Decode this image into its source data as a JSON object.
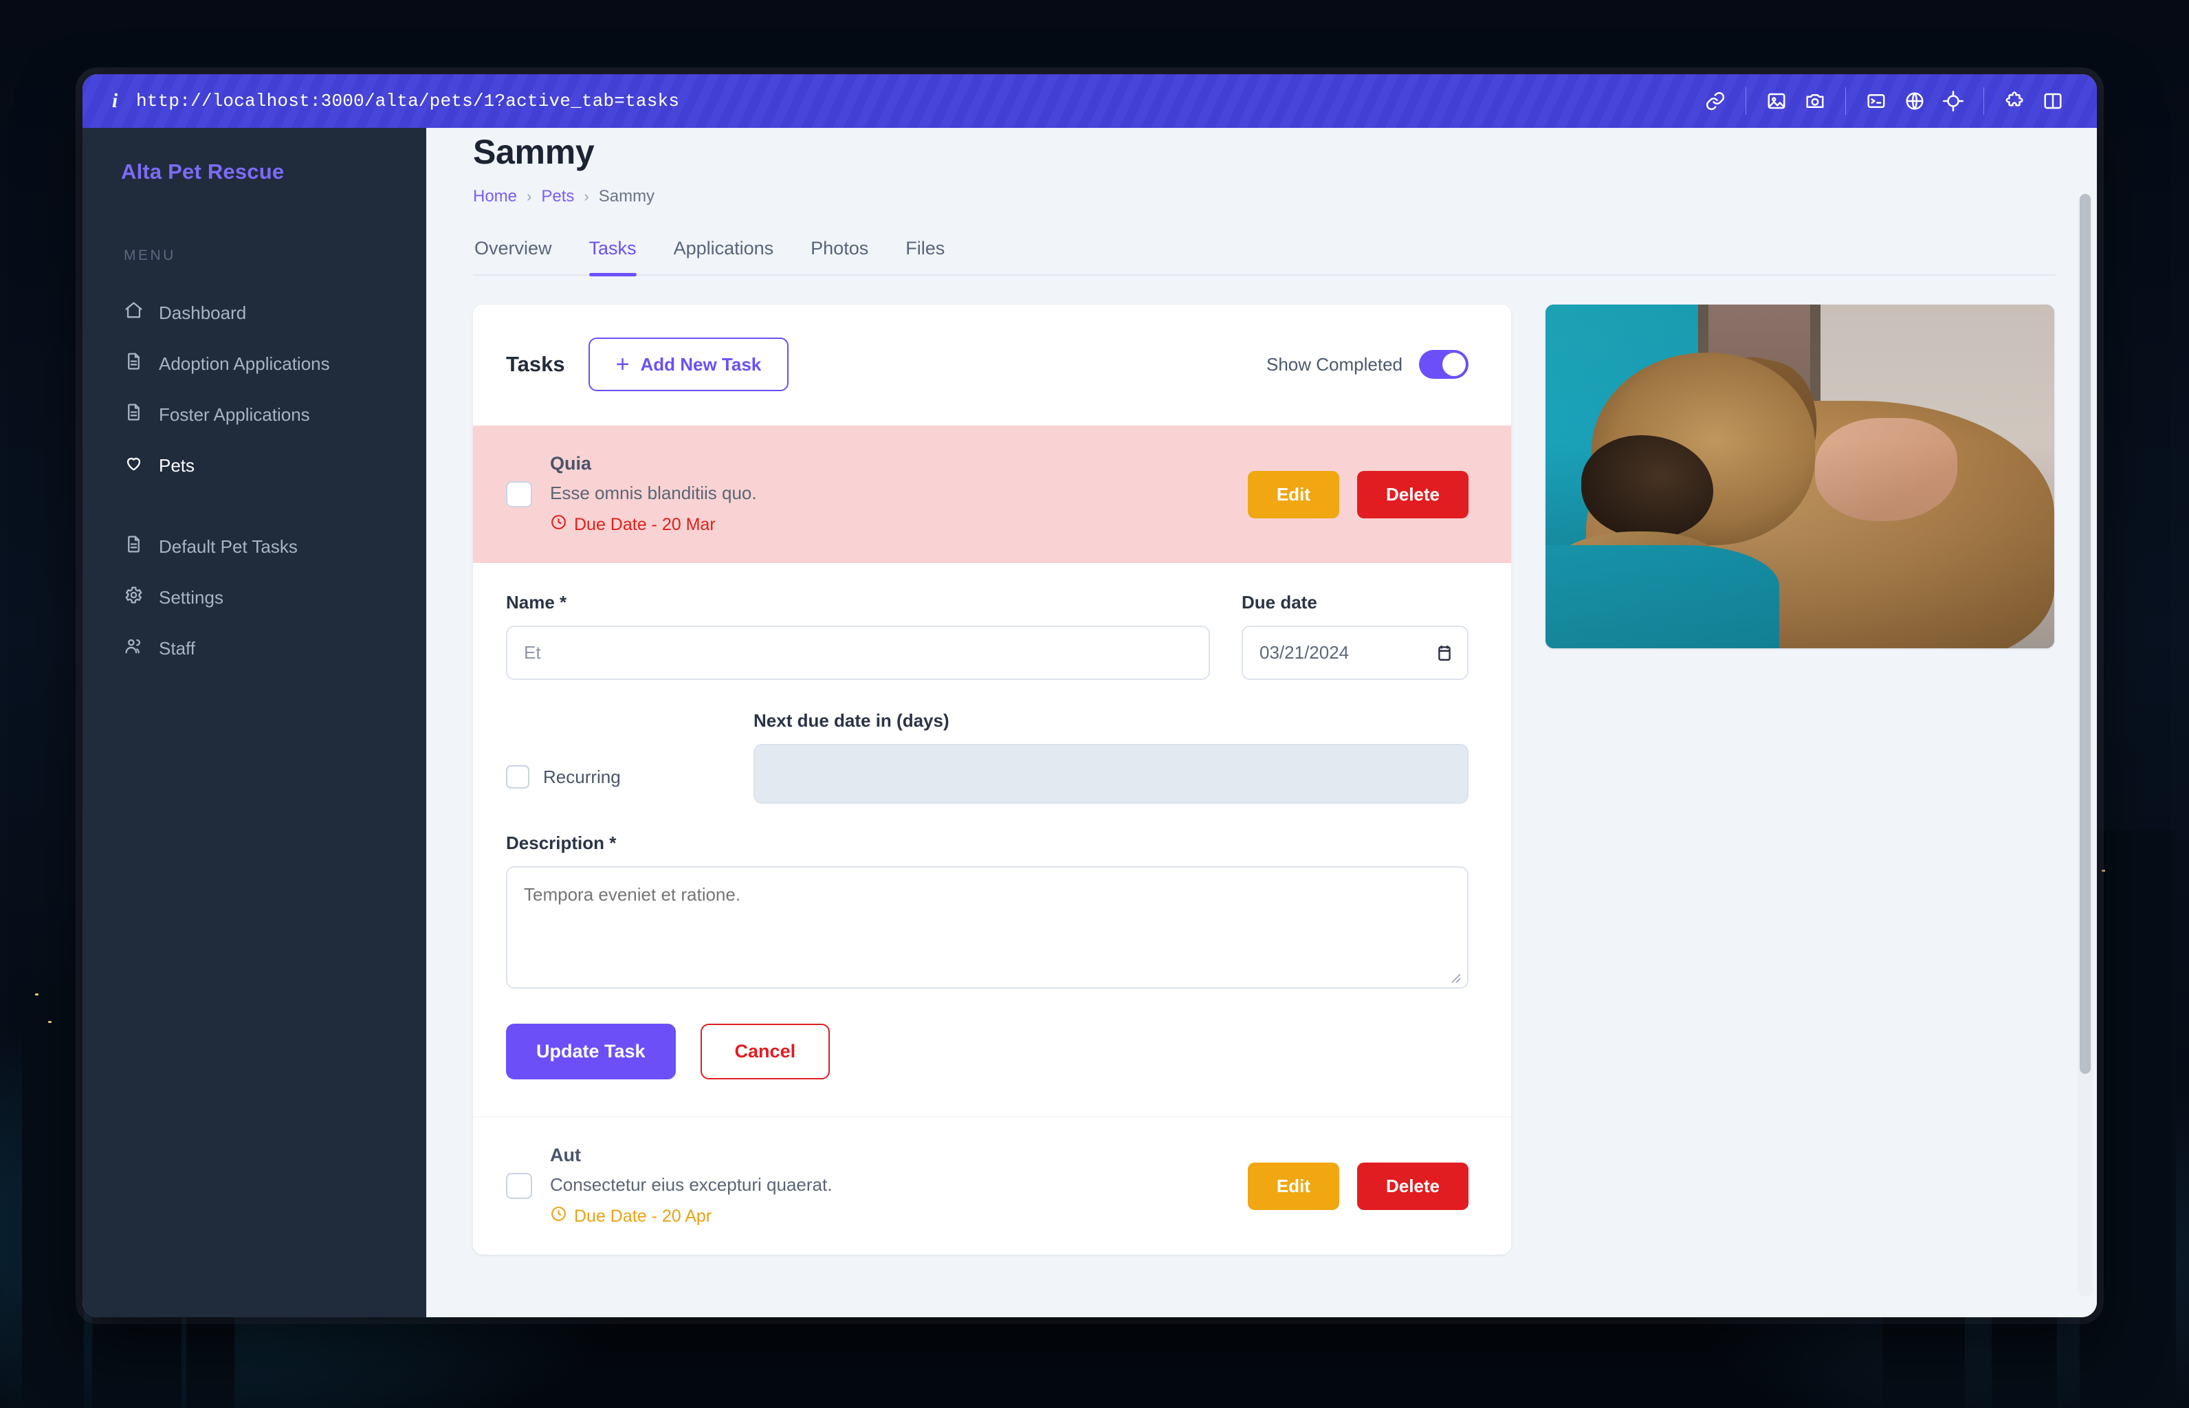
{
  "browser": {
    "info_icon": "info-icon",
    "url": "http://localhost:3000/alta/pets/1?active_tab=tasks",
    "toolbar_icons": [
      "link-icon",
      "image-icon",
      "camera-icon",
      "terminal-icon",
      "globe-icon",
      "target-icon",
      "puzzle-icon",
      "split-panel-icon"
    ]
  },
  "sidebar": {
    "brand": "Alta Pet Rescue",
    "menu_label": "MENU",
    "items": [
      {
        "label": "Dashboard",
        "icon": "home-icon",
        "active": false
      },
      {
        "label": "Adoption Applications",
        "icon": "document-icon",
        "active": false
      },
      {
        "label": "Foster Applications",
        "icon": "document-icon",
        "active": false
      },
      {
        "label": "Pets",
        "icon": "heart-icon",
        "active": true
      },
      {
        "label": "Default Pet Tasks",
        "icon": "document-icon",
        "active": false
      },
      {
        "label": "Settings",
        "icon": "gear-icon",
        "active": false
      },
      {
        "label": "Staff",
        "icon": "users-icon",
        "active": false
      }
    ]
  },
  "page": {
    "title": "Sammy",
    "breadcrumb": {
      "home": "Home",
      "pets": "Pets",
      "current": "Sammy",
      "separator": "›"
    },
    "tabs": [
      {
        "label": "Overview",
        "active": false
      },
      {
        "label": "Tasks",
        "active": true
      },
      {
        "label": "Applications",
        "active": false
      },
      {
        "label": "Photos",
        "active": false
      },
      {
        "label": "Files",
        "active": false
      }
    ]
  },
  "tasks_panel": {
    "title": "Tasks",
    "add_button": "Add New Task",
    "add_button_icon": "plus-icon",
    "show_completed_label": "Show Completed",
    "show_completed_on": true,
    "tasks": [
      {
        "name": "Quia",
        "description": "Esse omnis blanditiis quo.",
        "due_text": "Due Date - 20 Mar",
        "due_color": "#e0201c",
        "state": "overdue",
        "checked": false,
        "edit_label": "Edit",
        "delete_label": "Delete"
      },
      {
        "name": "Aut",
        "description": "Consectetur eius excepturi quaerat.",
        "due_text": "Due Date - 20 Apr",
        "due_color": "#e8a313",
        "state": "upcoming",
        "checked": false,
        "edit_label": "Edit",
        "delete_label": "Delete"
      }
    ]
  },
  "edit_form": {
    "name_label": "Name *",
    "name_value": "Et",
    "name_placeholder": "Et",
    "due_date_label": "Due date",
    "due_date_value": "03/21/2024",
    "due_date_icon": "calendar-icon",
    "recurring_label": "Recurring",
    "recurring_checked": false,
    "next_due_label": "Next due date in (days)",
    "next_due_value": "",
    "next_due_disabled": true,
    "description_label": "Description *",
    "description_value": "Tempora eveniet et ratione.",
    "description_placeholder": "Tempora eveniet et ratione.",
    "submit_label": "Update Task",
    "cancel_label": "Cancel"
  },
  "photo": {
    "alt": "sleeping puppy held in arms",
    "name": "pet-photo"
  },
  "colors": {
    "accent": "#6c4ff7",
    "url_bar": "#4240d4",
    "sidebar": "#202b3c",
    "page_bg": "#f1f4f9",
    "danger": "#e11d21",
    "warning": "#f0a712",
    "overdue_bg": "#f9d3d3"
  }
}
